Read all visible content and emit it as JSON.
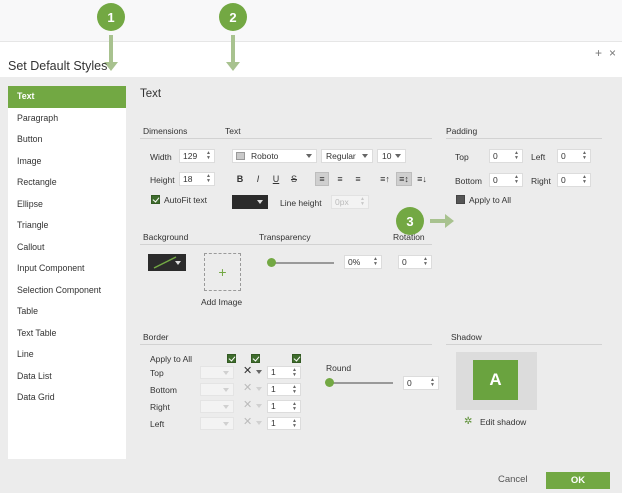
{
  "callouts": [
    "1",
    "2",
    "3"
  ],
  "dialog": {
    "title": "Set Default Styles",
    "add_glyph": "+",
    "close_glyph": "×"
  },
  "sidebar": {
    "items": [
      {
        "label": "Text",
        "active": true
      },
      {
        "label": "Paragraph"
      },
      {
        "label": "Button"
      },
      {
        "label": "Image"
      },
      {
        "label": "Rectangle"
      },
      {
        "label": "Ellipse"
      },
      {
        "label": "Triangle"
      },
      {
        "label": "Callout"
      },
      {
        "label": "Input Component"
      },
      {
        "label": "Selection Component"
      },
      {
        "label": "Table"
      },
      {
        "label": "Text Table"
      },
      {
        "label": "Line"
      },
      {
        "label": "Data List"
      },
      {
        "label": "Data Grid"
      }
    ]
  },
  "panel": {
    "title": "Text",
    "dimensions": {
      "section": "Dimensions",
      "width_label": "Width",
      "width": "129",
      "height_label": "Height",
      "height": "18",
      "autofit_label": "AutoFit text"
    },
    "text": {
      "section": "Text",
      "font": "Roboto",
      "weight": "Regular",
      "size": "10",
      "bold": "B",
      "italic": "I",
      "underline": "U",
      "strike": "S",
      "align_left": "≡",
      "align_center": "≡",
      "align_right": "≡",
      "spacing_up": "≡↑",
      "spacing_mid": "≡↕",
      "spacing_down": "≡↓",
      "line_height_label": "Line height",
      "line_height": "0px",
      "color": "#2b2b2b"
    },
    "padding": {
      "section": "Padding",
      "top_label": "Top",
      "top": "0",
      "left_label": "Left",
      "left": "0",
      "bottom_label": "Bottom",
      "bottom": "0",
      "right_label": "Right",
      "right": "0",
      "apply_all_label": "Apply to All"
    },
    "background": {
      "section": "Background",
      "add_image_label": "Add Image",
      "plus": "+"
    },
    "transparency": {
      "section": "Transparency",
      "value": "0%",
      "level": 0
    },
    "rotation": {
      "section": "Rotation",
      "value": "0"
    },
    "border": {
      "section": "Border",
      "apply_all_label": "Apply to All",
      "rows": [
        {
          "label": "Top",
          "width": "1"
        },
        {
          "label": "Bottom",
          "width": "1"
        },
        {
          "label": "Right",
          "width": "1"
        },
        {
          "label": "Left",
          "width": "1"
        }
      ],
      "round_label": "Round",
      "round_value": "0"
    },
    "shadow": {
      "section": "Shadow",
      "tile_letter": "A",
      "edit_label": "Edit shadow"
    }
  },
  "footer": {
    "cancel_label": "Cancel",
    "ok_label": "OK"
  },
  "colors": {
    "accent": "#72a843",
    "panel": "#ececec",
    "callout_arrow": "#a8c28f"
  }
}
